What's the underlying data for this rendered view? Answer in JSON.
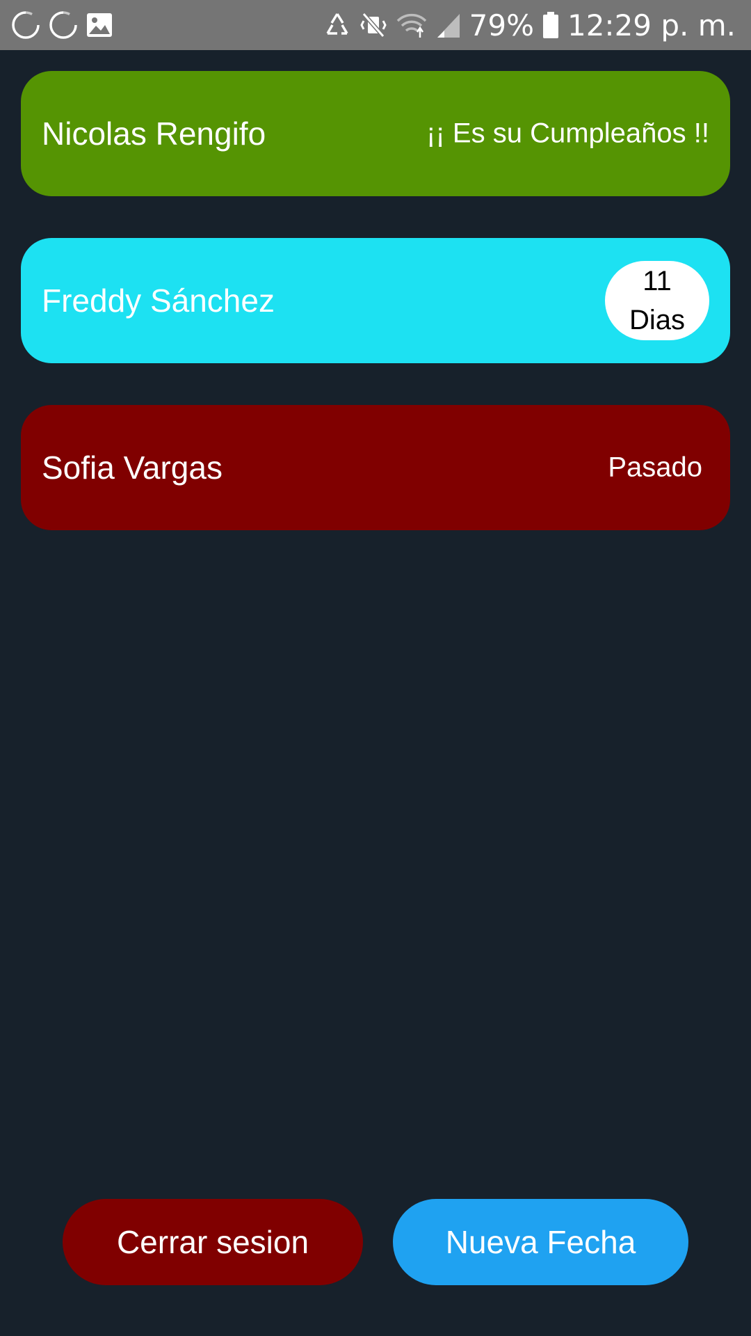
{
  "status_bar": {
    "battery_percent": "79%",
    "time": "12:29 p. m.",
    "icons": [
      "sync-icon",
      "sync-icon",
      "image-icon",
      "recycle-icon",
      "vibrate-off-icon",
      "wifi-icon",
      "signal-icon",
      "battery-icon"
    ]
  },
  "birthdays": [
    {
      "name": "Nicolas Rengifo",
      "status": "¡¡ Es su Cumpleaños !!",
      "color": "#559403"
    },
    {
      "name": "Freddy Sánchez",
      "days_number": "11",
      "days_label": "Dias",
      "color": "#1de1f2"
    },
    {
      "name": "Sofia Vargas",
      "status": "Pasado",
      "color": "#800000"
    }
  ],
  "buttons": {
    "logout": {
      "label": "Cerrar sesion",
      "color": "#800000"
    },
    "new_date": {
      "label": "Nueva Fecha",
      "color": "#1fa2f1"
    }
  }
}
